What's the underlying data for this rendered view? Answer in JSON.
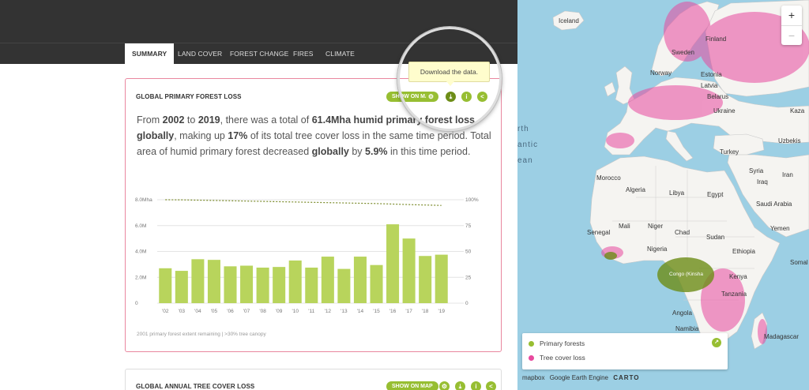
{
  "tabs": [
    {
      "label": "SUMMARY",
      "active": true
    },
    {
      "label": "LAND COVER",
      "active": false
    },
    {
      "label": "FOREST CHANGE",
      "active": false
    },
    {
      "label": "FIRES",
      "active": false
    },
    {
      "label": "CLIMATE",
      "active": false
    }
  ],
  "widget1": {
    "title": "GLOBAL PRIMARY FOREST LOSS",
    "show_on_map": "SHOW ON MAP",
    "tooltip": "Download the data.",
    "summary": {
      "t1": "From ",
      "start_year": "2002",
      "t2": " to ",
      "end_year": "2019",
      "t3": ", there was a total of ",
      "total": "61.4Mha humid primary forest loss",
      "t4": " ",
      "scope": "globally",
      "t5": ", making up ",
      "percent": "17%",
      "t6": " of its total tree cover loss in the same time period. Total area of humid primary forest decreased ",
      "scope2": "globally",
      "t7": " by ",
      "decrease": "5.9%",
      "t8": " in this time period."
    },
    "footnote": "2001 primary forest extent remaining | >30% tree canopy"
  },
  "widget2": {
    "title": "GLOBAL ANNUAL TREE COVER LOSS",
    "show_on_map": "SHOW ON MAP"
  },
  "chart_data": {
    "type": "bar",
    "categories": [
      "'02",
      "'03",
      "'04",
      "'05",
      "'06",
      "'07",
      "'08",
      "'09",
      "'10",
      "'11",
      "'12",
      "'13",
      "'14",
      "'15",
      "'16",
      "'17",
      "'18",
      "'19"
    ],
    "series": [
      {
        "values": [
          2.7,
          2.5,
          3.4,
          3.35,
          2.85,
          2.9,
          2.75,
          2.8,
          3.3,
          2.75,
          3.6,
          2.65,
          3.6,
          2.95,
          6.1,
          5.0,
          3.65,
          3.75
        ]
      },
      {
        "values": [
          100,
          99.9,
          99.6,
          99.3,
          99.0,
          98.7,
          98.4,
          98.1,
          97.8,
          97.5,
          97.2,
          96.9,
          96.6,
          96.3,
          95.8,
          95.3,
          94.9,
          94.5
        ]
      }
    ],
    "yticks_left": [
      "0",
      "2.0M",
      "4.0M",
      "6.0M",
      "8.0Mha"
    ],
    "yticks_right": [
      "0",
      "25",
      "50",
      "75",
      "100%"
    ],
    "ylim_left": [
      0,
      8
    ],
    "ylim_right": [
      0,
      100
    ],
    "bar_color": "#b8d45c",
    "line_color": "#7a8a2a"
  },
  "map": {
    "labels": {
      "iceland": "Iceland",
      "finland": "Finland",
      "sweden": "Sweden",
      "norway": "Norway",
      "estonia": "Estonia",
      "latvia": "Latvia",
      "belarus": "Belarus",
      "ukraine": "Ukraine",
      "kazakhstan": "Kaza",
      "uzbekistan": "Uzbekis",
      "turkey": "Turkey",
      "syria": "Syria",
      "iraq": "Iraq",
      "iran": "Iran",
      "morocco": "Morocco",
      "algeria": "Algeria",
      "libya": "Libya",
      "egypt": "Egypt",
      "saudi": "Saudi Arabia",
      "yemen": "Yemen",
      "senegal": "Senegal",
      "mali": "Mali",
      "niger": "Niger",
      "chad": "Chad",
      "sudan": "Sudan",
      "nigeria": "Nigeria",
      "ethiopia": "Ethiopia",
      "somalia": "Somal",
      "drc": "Congo (Kinsha",
      "kenya": "Kenya",
      "tanzania": "Tanzania",
      "angola": "Angola",
      "namibia": "Namibia",
      "madagascar": "Madagascar"
    },
    "ocean_label": [
      "rth",
      "antic",
      "ean"
    ],
    "zoom_in": "+",
    "zoom_out": "−",
    "legend": {
      "primary": "Primary forests",
      "loss": "Tree cover loss",
      "primary_color": "#97be32",
      "loss_color": "#e8499e"
    },
    "attribution": [
      "mapbox",
      "Google Earth Engine",
      "CARTO"
    ]
  }
}
